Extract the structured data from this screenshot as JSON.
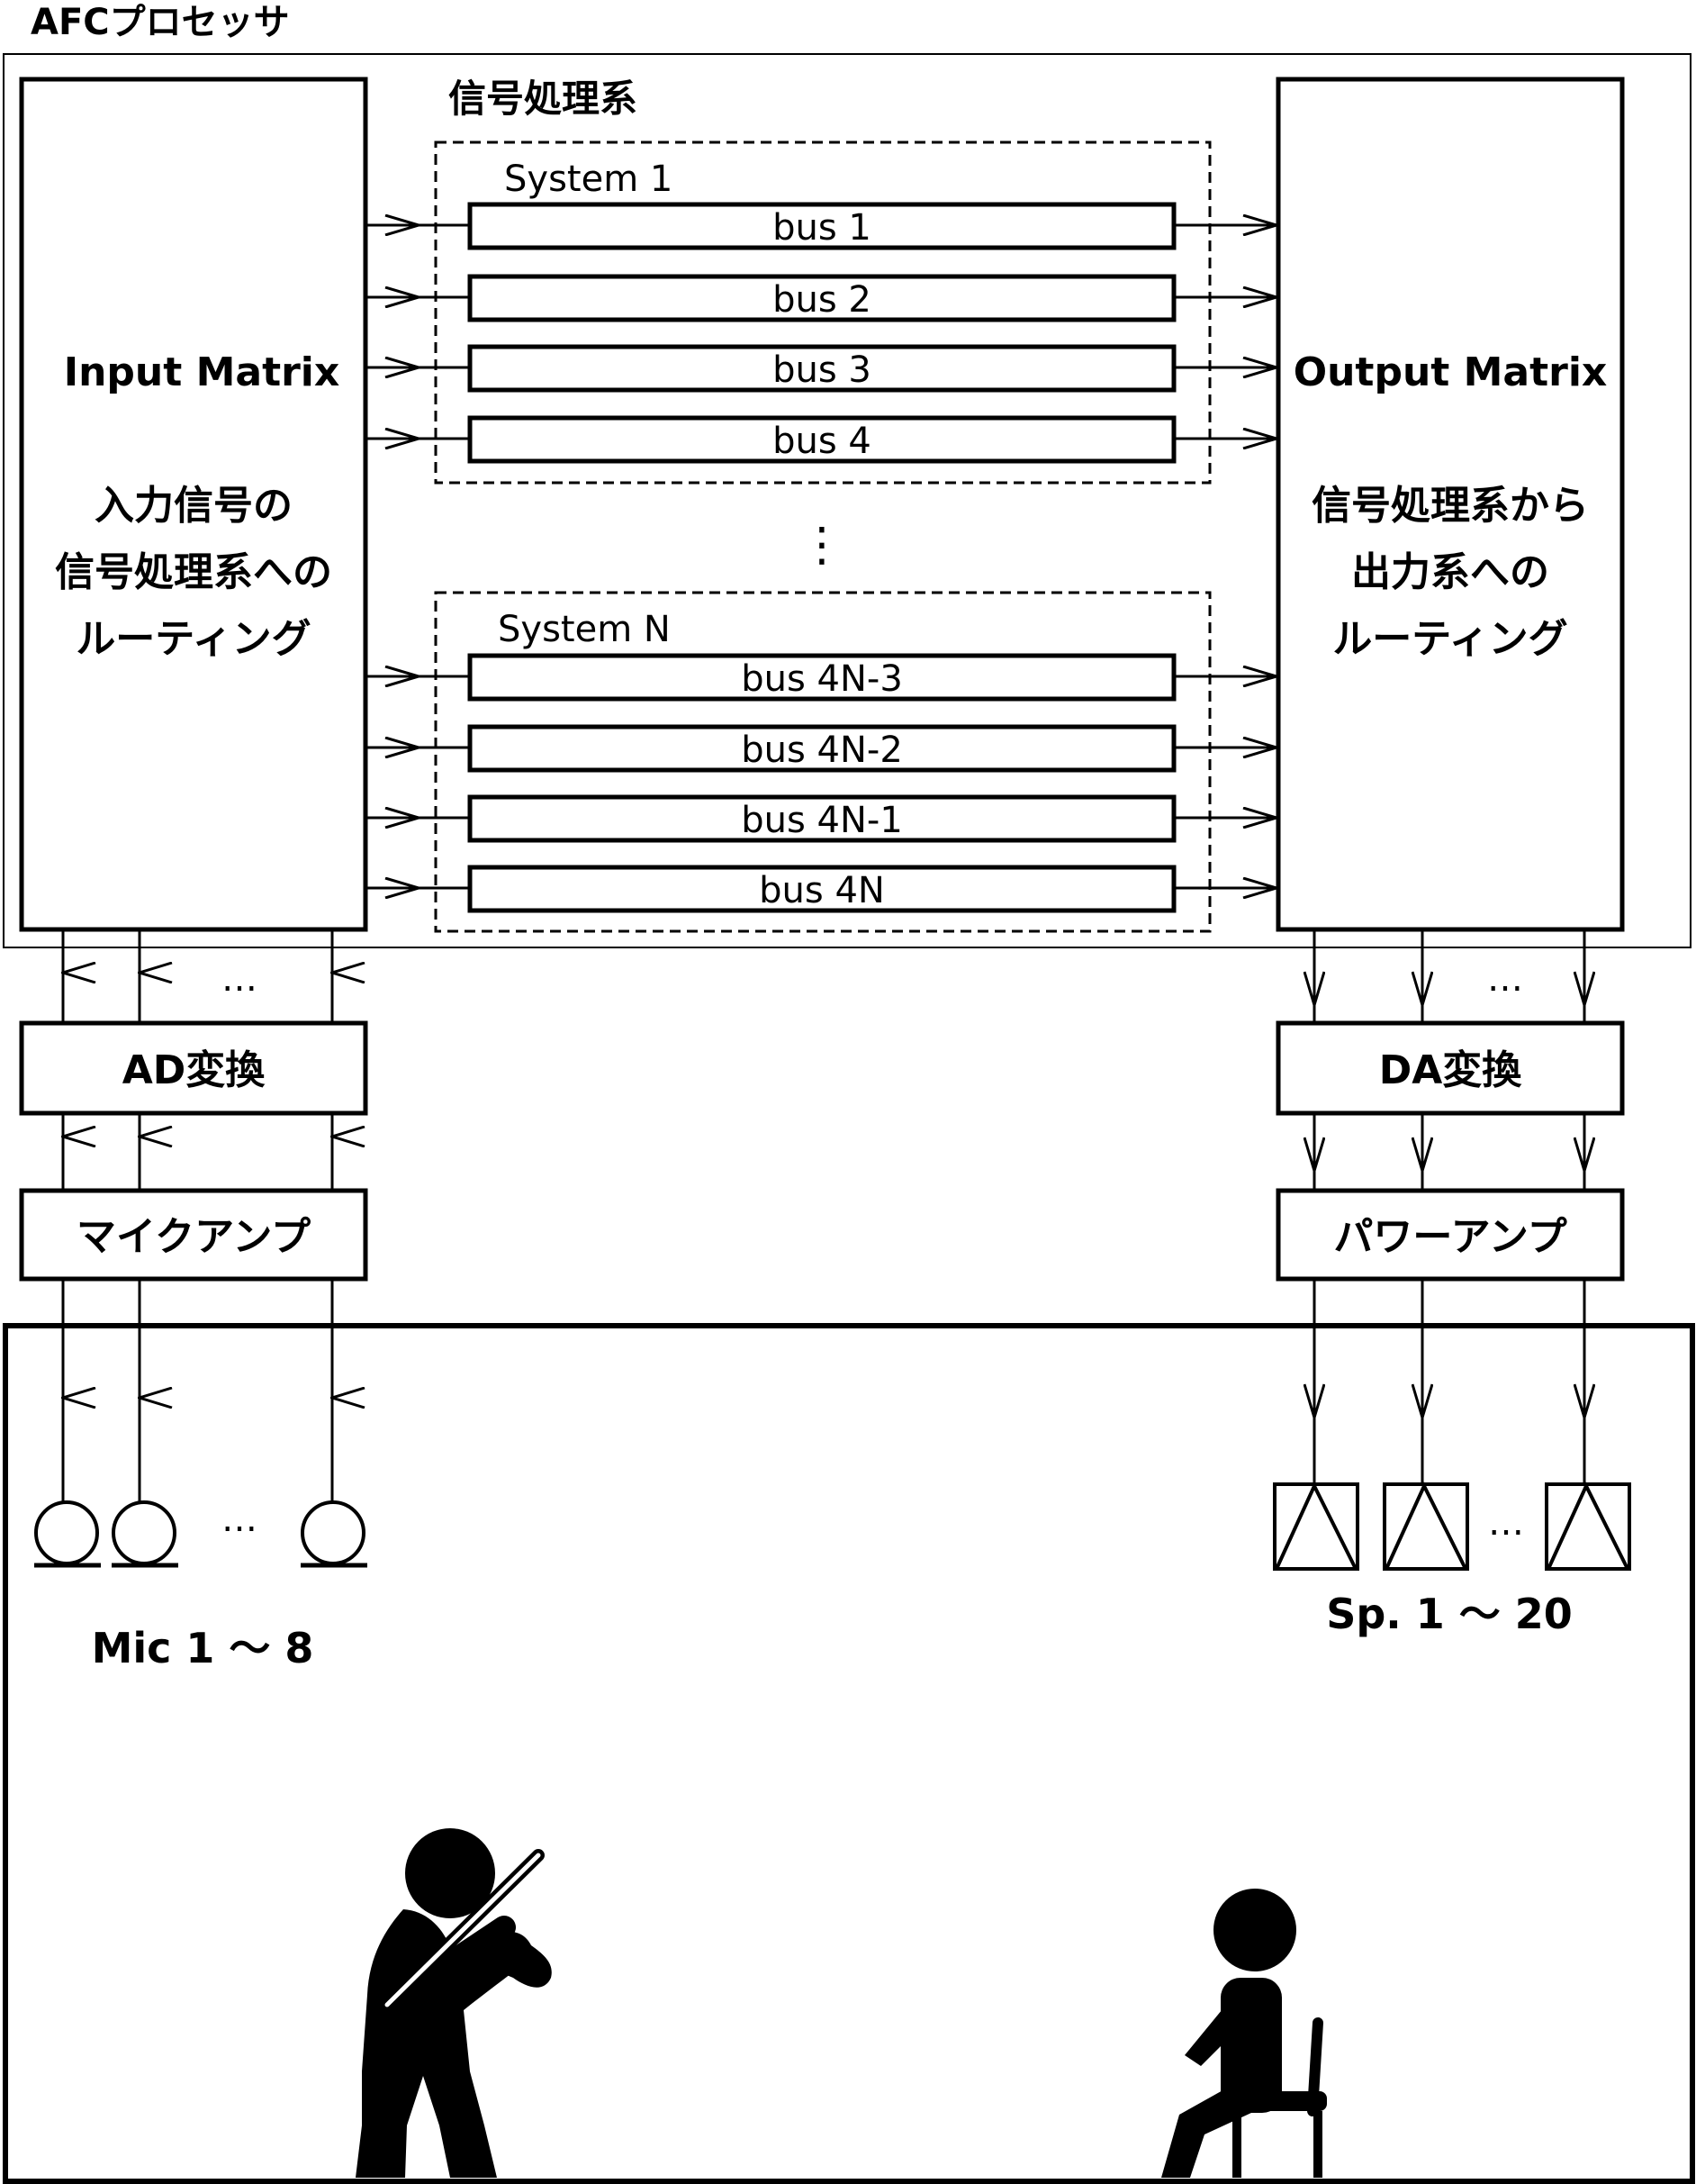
{
  "processor": {
    "title": "AFCプロセッサ",
    "signal_system_label": "信号処理系"
  },
  "input_matrix": {
    "title": "Input Matrix",
    "desc_lines": [
      "入力信号の",
      "信号処理系への",
      "ルーティング"
    ]
  },
  "output_matrix": {
    "title": "Output Matrix",
    "desc_lines": [
      "信号処理系から",
      "出力系への",
      "ルーティング"
    ]
  },
  "systems": [
    {
      "label": "System 1",
      "buses": [
        "bus 1",
        "bus 2",
        "bus 3",
        "bus 4"
      ]
    },
    {
      "label": "System N",
      "buses": [
        "bus 4N-3",
        "bus 4N-2",
        "bus 4N-1",
        "bus 4N"
      ]
    }
  ],
  "ellipsis_vertical": "⋮",
  "ellipsis": "…",
  "input_chain": {
    "ad_label": "AD変換",
    "amp_label": "マイクアンプ",
    "mic_label": "Mic 1 ～ 8"
  },
  "output_chain": {
    "da_label": "DA変換",
    "amp_label": "パワーアンプ",
    "speaker_label": "Sp. 1 ～ 20"
  },
  "icons": [
    "microphone-icon",
    "speaker-icon",
    "violinist-icon",
    "seated-listener-icon",
    "arrow-icon"
  ]
}
